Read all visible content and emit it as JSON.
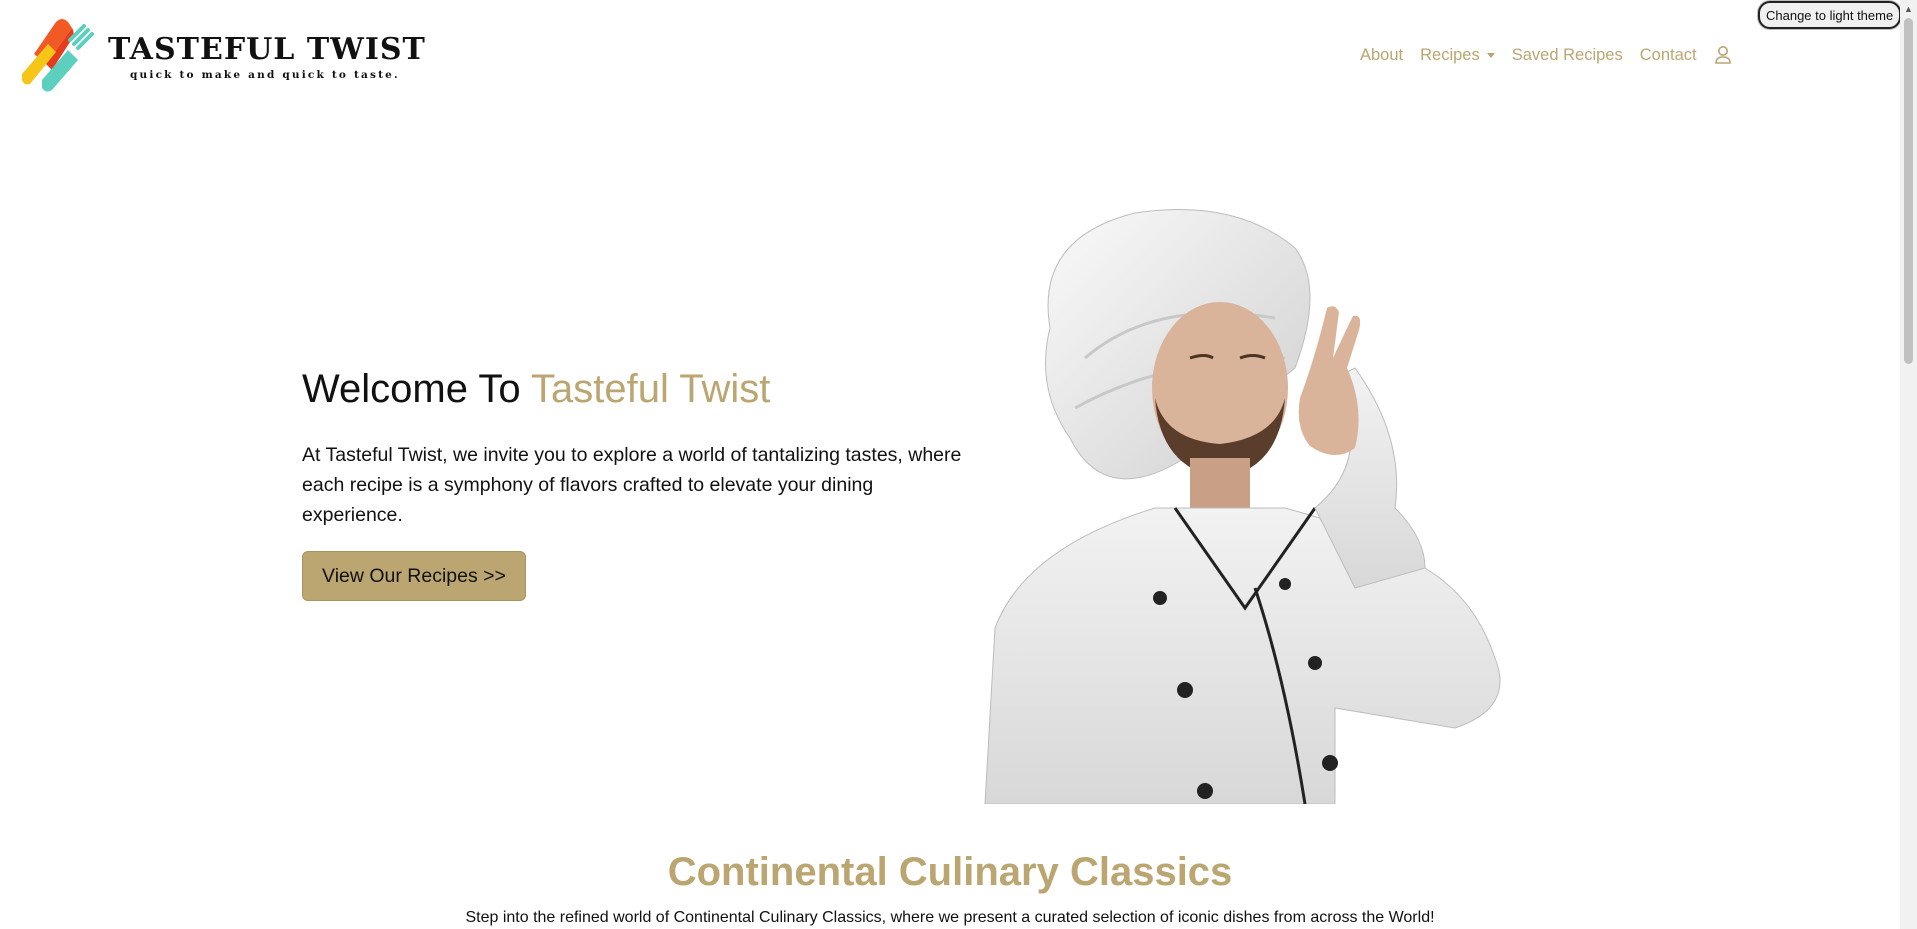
{
  "brand": {
    "name": "TASTEFUL TWIST",
    "tagline": "quick to make and quick to taste.",
    "colors": {
      "accent": "#bba672",
      "logo_orange": "#f15a24",
      "logo_yellow": "#f5c518",
      "logo_teal": "#5ccfbf"
    }
  },
  "theme_toggle": {
    "label": "Change to light theme"
  },
  "nav": {
    "about": "About",
    "recipes": "Recipes",
    "saved": "Saved Recipes",
    "contact": "Contact",
    "user_icon": "user-icon"
  },
  "hero": {
    "title_plain": "Welcome To ",
    "title_accent": "Tasteful Twist",
    "description": "At Tasteful Twist, we invite you to explore a world of tantalizing tastes, where each recipe is a symphony of flavors crafted to elevate your dining experience.",
    "cta": "View Our Recipes >>",
    "image": "chef kissing fingers photo"
  },
  "section": {
    "title": "Continental Culinary Classics",
    "description": "Step into the refined world of Continental Culinary Classics, where we present a curated selection of iconic dishes from across the World!"
  }
}
